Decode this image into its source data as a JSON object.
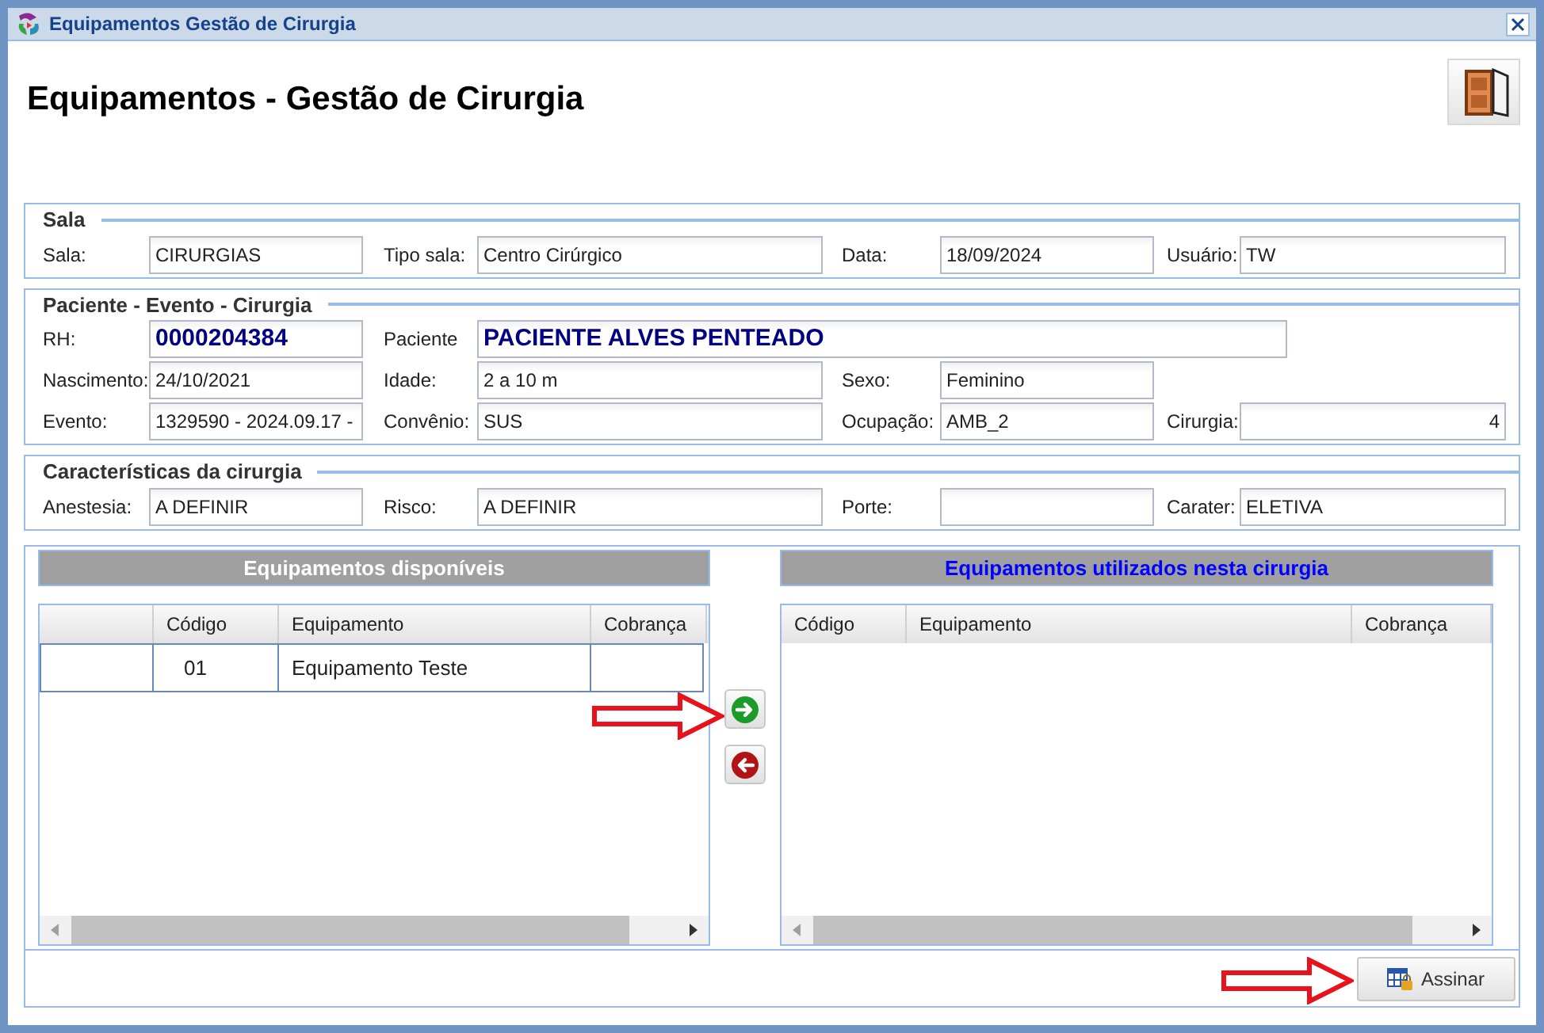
{
  "window": {
    "title": "Equipamentos Gestão de Cirurgia"
  },
  "page_title": "Equipamentos - Gestão de Cirurgia",
  "sections": [
    {
      "title": "Sala",
      "rows": [
        [
          {
            "label": "Sala:",
            "value": "CIRURGIAS",
            "kind": "plain"
          },
          {
            "label": "Tipo sala:",
            "value": "Centro Cirúrgico",
            "kind": "plain"
          },
          {
            "label": "Data:",
            "value": "18/09/2024",
            "kind": "plain"
          },
          {
            "label": "Usuário:",
            "value": "TW",
            "kind": "plain"
          }
        ]
      ]
    },
    {
      "title": "Paciente - Evento - Cirurgia",
      "rows": [
        [
          {
            "label": "RH:",
            "value": "0000204384",
            "kind": "bold"
          },
          {
            "label": "Paciente",
            "value": "PACIENTE ALVES PENTEADO",
            "kind": "bold-wide"
          }
        ],
        [
          {
            "label": "Nascimento:",
            "value": "24/10/2021",
            "kind": "plain"
          },
          {
            "label": "Idade:",
            "value": "2 a 10 m",
            "kind": "plain"
          },
          {
            "label": "Sexo:",
            "value": "Feminino",
            "kind": "plain"
          }
        ],
        [
          {
            "label": "Evento:",
            "value": "1329590 - 2024.09.17 -",
            "kind": "plain"
          },
          {
            "label": "Convênio:",
            "value": "SUS",
            "kind": "plain"
          },
          {
            "label": "Ocupação:",
            "value": "AMB_2",
            "kind": "plain"
          },
          {
            "label": "Cirurgia:",
            "value": "4",
            "kind": "number"
          }
        ]
      ]
    },
    {
      "title": "Características da cirurgia",
      "rows": [
        [
          {
            "label": "Anestesia:",
            "value": "A DEFINIR",
            "kind": "plain"
          },
          {
            "label": "Risco:",
            "value": "A DEFINIR",
            "kind": "plain"
          },
          {
            "label": "Porte:",
            "kind": "plain"
          },
          {
            "label": "Carater:",
            "value": "ELETIVA",
            "kind": "plain"
          }
        ]
      ]
    }
  ],
  "available": {
    "title": "Equipamentos disponíveis",
    "kind": "source",
    "columns": [
      "Código",
      "Equipamento",
      "Cobrança"
    ],
    "rows": [
      {
        "code": "01",
        "name": "Equipamento Teste"
      }
    ]
  },
  "used": {
    "title": "Equipamentos utilizados nesta cirurgia",
    "kind": "target",
    "columns": [
      "Código",
      "Equipamento",
      "Cobrança"
    ]
  },
  "footer": {
    "button": "Assinar"
  }
}
